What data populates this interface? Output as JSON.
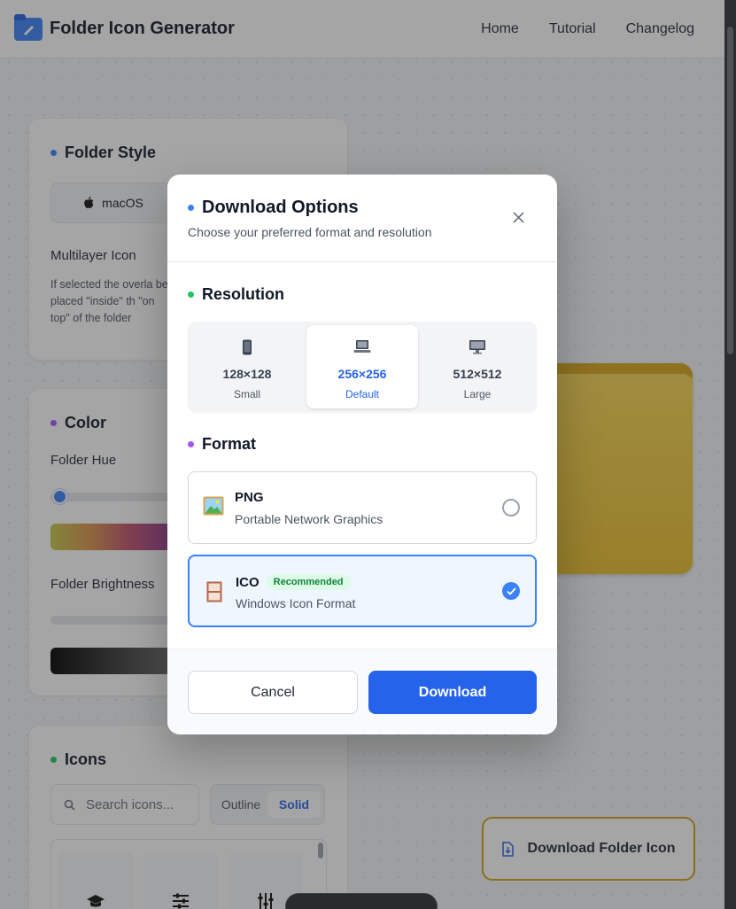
{
  "header": {
    "app_title": "Folder Icon Generator",
    "nav": [
      "Home",
      "Tutorial",
      "Changelog"
    ]
  },
  "folder_style": {
    "title": "Folder Style",
    "os_option": "macOS",
    "multilayer_label": "Multilayer Icon",
    "multilayer_desc": "If selected the overla be placed \"inside\" th \"on top\" of the folder"
  },
  "color": {
    "title": "Color",
    "hue_label": "Folder Hue",
    "hue_value": 0.02,
    "brightness_label": "Folder Brightness"
  },
  "icons": {
    "title": "Icons",
    "search_placeholder": "Search icons...",
    "style_options": [
      "Outline",
      "Solid"
    ],
    "selected_style": "Solid"
  },
  "download_folder_button": "Download Folder Icon",
  "modal": {
    "title": "Download Options",
    "subtitle": "Choose your preferred format and resolution",
    "resolution_title": "Resolution",
    "resolutions": [
      {
        "icon": "mobile-icon",
        "value": "128×128",
        "label": "Small"
      },
      {
        "icon": "laptop-icon",
        "value": "256×256",
        "label": "Default"
      },
      {
        "icon": "desktop-icon",
        "value": "512×512",
        "label": "Large"
      }
    ],
    "selected_resolution": "256×256",
    "format_title": "Format",
    "formats": [
      {
        "icon": "picture-icon",
        "name": "PNG",
        "desc": "Portable Network Graphics",
        "badge": ""
      },
      {
        "icon": "window-icon",
        "name": "ICO",
        "desc": "Windows Icon Format",
        "badge": "Recommended"
      }
    ],
    "selected_format": "ICO",
    "cancel_label": "Cancel",
    "download_label": "Download"
  },
  "colors": {
    "primary": "#2563eb",
    "accent_blue_dot": "#3b82f6",
    "green_dot": "#22c55e",
    "purple_dot": "#a855f7",
    "folder_yellow": "#f3cf45"
  }
}
